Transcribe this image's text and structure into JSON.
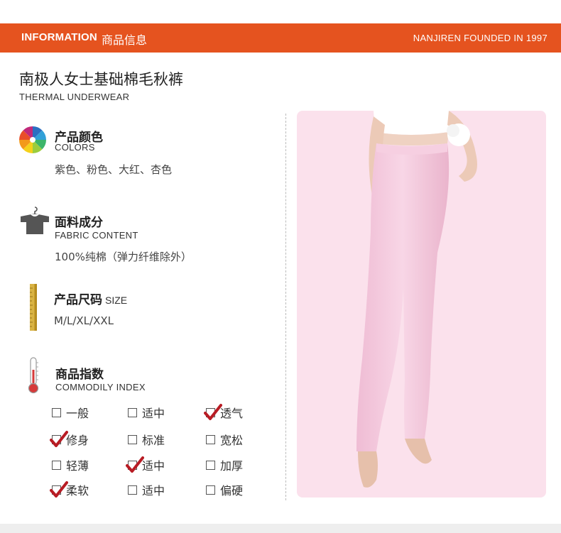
{
  "banner": {
    "en": "INFORMATION",
    "cn": "商品信息",
    "brand": "NANJIREN FOUNDED IN 1997",
    "color": "#e5531f"
  },
  "product": {
    "title": "南极人女士基础棉毛秋裤",
    "subtitle": "THERMAL UNDERWEAR"
  },
  "colors": {
    "icon": "color-swatch-fan-icon",
    "title": "产品颜色",
    "subtitle": "COLORS",
    "value": "紫色、粉色、大红、杏色"
  },
  "fabric": {
    "icon": "shirt-on-hanger-icon",
    "title": "面料成分",
    "subtitle": "FABRIC CONTENT",
    "value": "100%纯棉（弹力纤维除外）"
  },
  "size": {
    "icon": "measuring-tape-icon",
    "title": "产品尺码",
    "suffix": "SIZE",
    "value": "M/L/XL/XXL"
  },
  "index": {
    "icon": "thermometer-icon",
    "title": "商品指数",
    "subtitle": "COMMODILY INDEX",
    "rows": [
      [
        {
          "label": "一般",
          "checked": false
        },
        {
          "label": "适中",
          "checked": false
        },
        {
          "label": "透气",
          "checked": true
        }
      ],
      [
        {
          "label": "修身",
          "checked": true
        },
        {
          "label": "标准",
          "checked": false
        },
        {
          "label": "宽松",
          "checked": false
        }
      ],
      [
        {
          "label": "轻薄",
          "checked": false
        },
        {
          "label": "适中",
          "checked": true
        },
        {
          "label": "加厚",
          "checked": false
        }
      ],
      [
        {
          "label": "柔软",
          "checked": true
        },
        {
          "label": "适中",
          "checked": false
        },
        {
          "label": "偏硬",
          "checked": false
        }
      ]
    ]
  },
  "photo": {
    "background": "#fbe1ec",
    "garment_color": "#f4c8dc",
    "check_color": "#b81c24"
  }
}
